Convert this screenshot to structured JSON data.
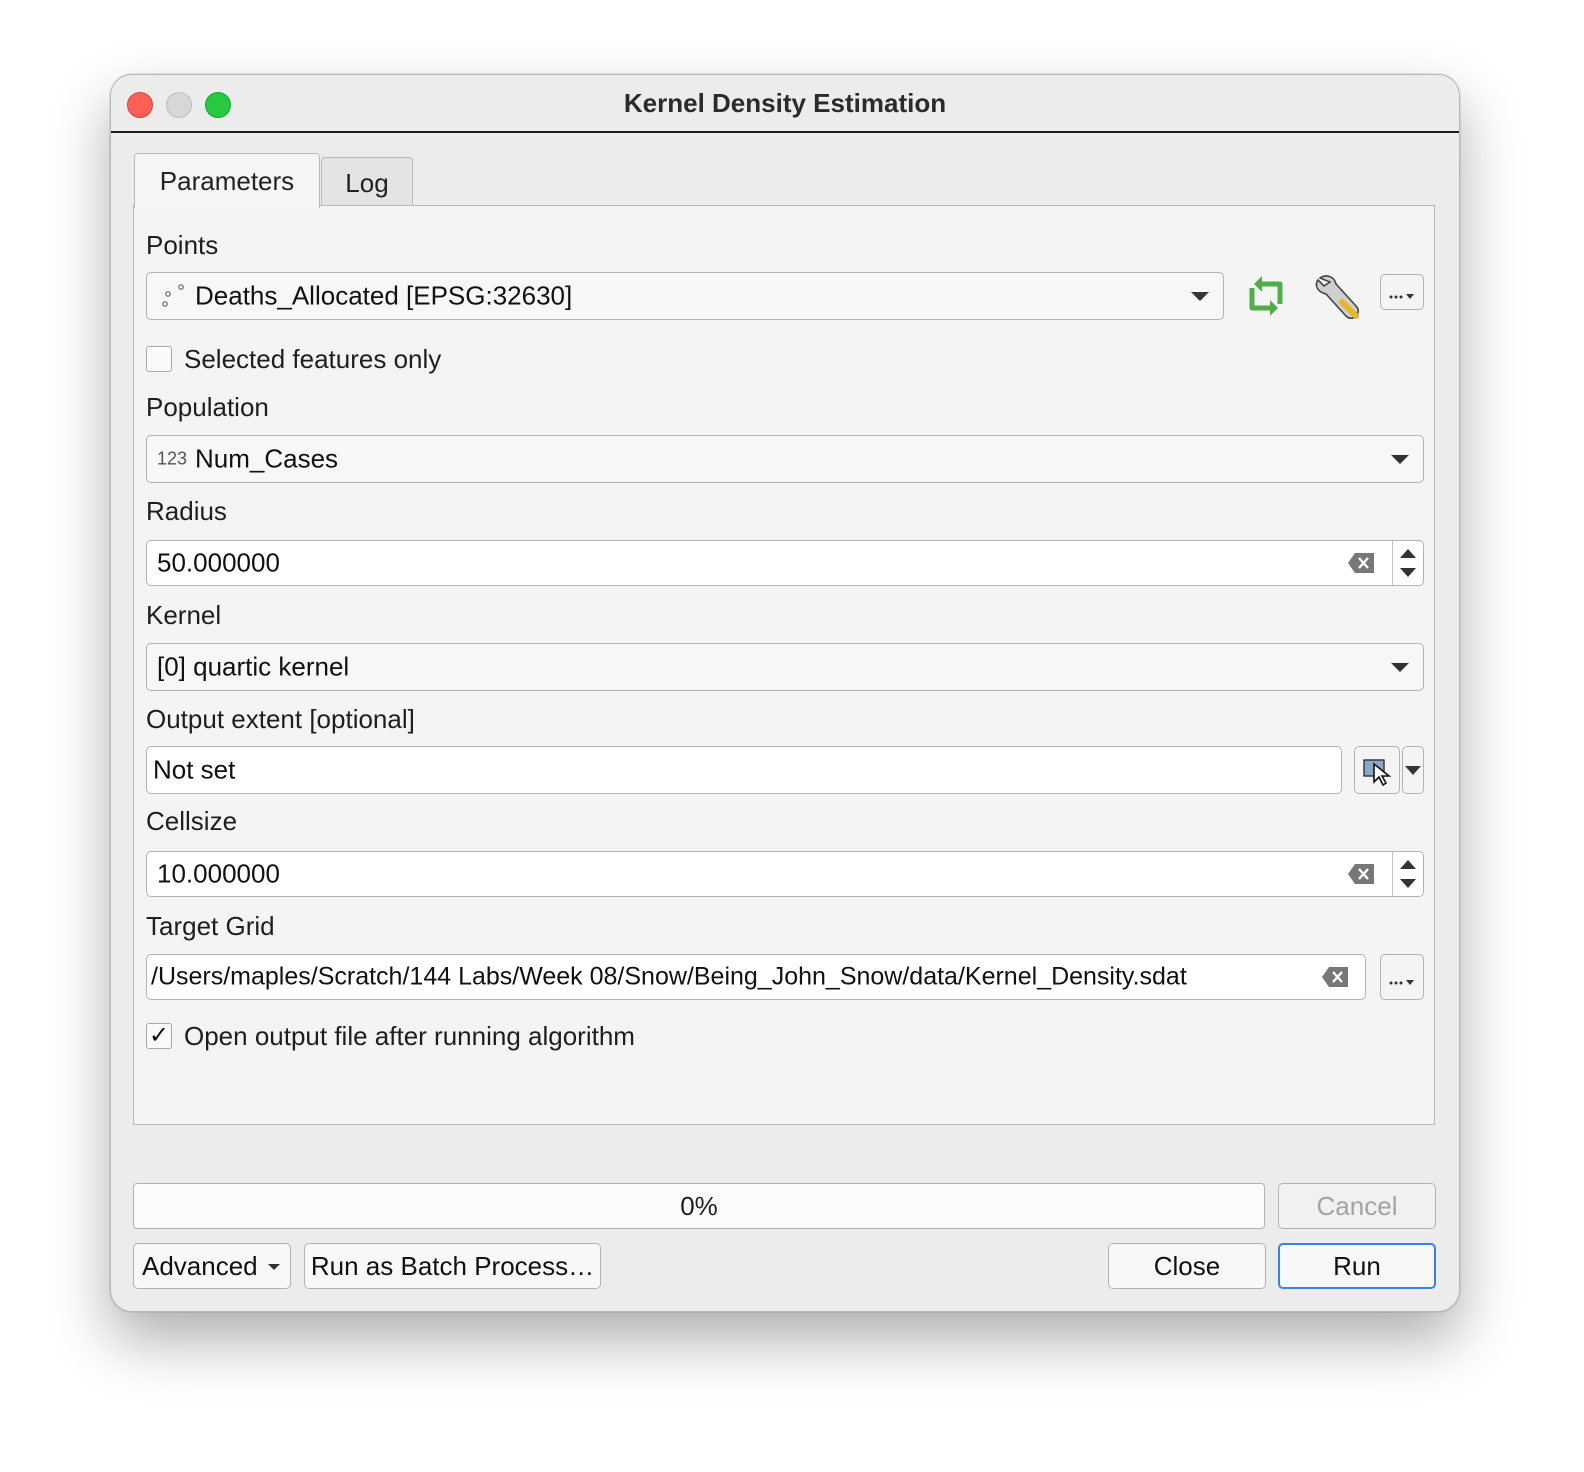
{
  "window": {
    "title": "Kernel Density Estimation"
  },
  "tabs": [
    {
      "label": "Parameters",
      "active": true
    },
    {
      "label": "Log",
      "active": false
    }
  ],
  "params": {
    "points": {
      "label": "Points",
      "value": "Deaths_Allocated [EPSG:32630]",
      "icon": "point-layer-icon",
      "side_icons": [
        "iterate-icon",
        "wrench-icon",
        "ellipsis-menu-icon"
      ]
    },
    "selected_only": {
      "label": "Selected features only",
      "checked": false
    },
    "population": {
      "label": "Population",
      "prefix": "123",
      "value": "Num_Cases"
    },
    "radius": {
      "label": "Radius",
      "value": "50.000000"
    },
    "kernel": {
      "label": "Kernel",
      "value": "[0] quartic kernel"
    },
    "extent": {
      "label": "Output extent [optional]",
      "value": "Not set"
    },
    "cellsize": {
      "label": "Cellsize",
      "value": "10.000000"
    },
    "target": {
      "label": "Target Grid",
      "value": "/Users/maples/Scratch/144 Labs/Week 08/Snow/Being_John_Snow/data/Kernel_Density.sdat"
    },
    "open_output": {
      "label": "Open output file after running algorithm",
      "checked": true,
      "check_mark": "✓"
    }
  },
  "progress": {
    "text": "0%",
    "value": 0
  },
  "buttons": {
    "cancel": "Cancel",
    "advanced": "Advanced",
    "batch": "Run as Batch Process…",
    "close": "Close",
    "run": "Run"
  },
  "colors": {
    "accent": "#3b83e0",
    "close_light": "#fe5f57",
    "min_light": "#d7d7d7",
    "max_light": "#28c840",
    "iterate_green": "#4fae4a"
  }
}
